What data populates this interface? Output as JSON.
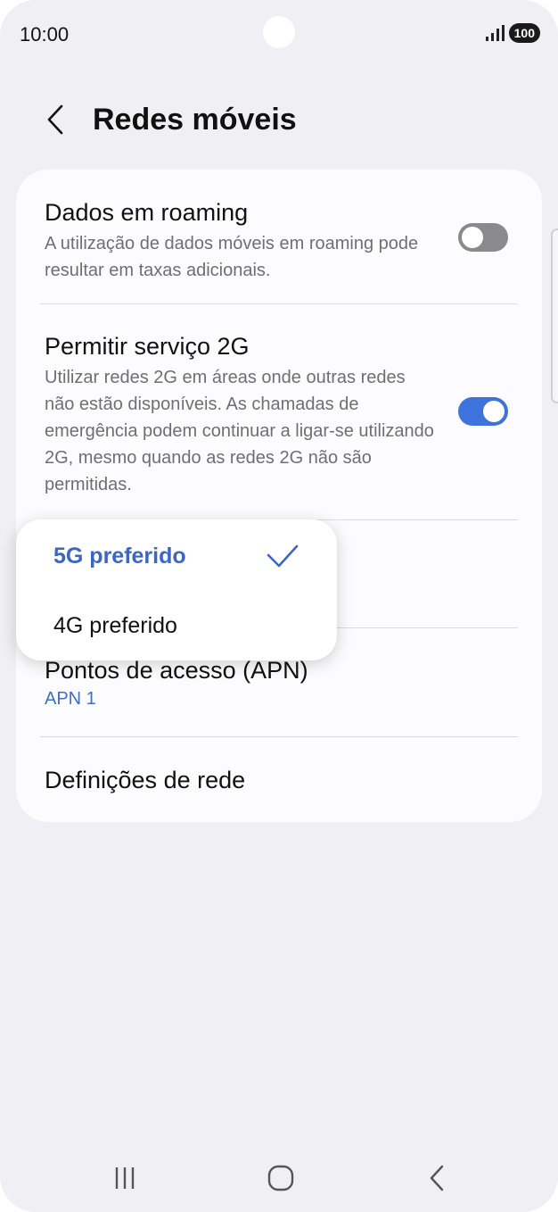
{
  "status_bar": {
    "time": "10:00",
    "battery": "100",
    "signal_icon": "signal-bars-icon"
  },
  "header": {
    "title": "Redes móveis",
    "back_icon": "chevron-left-icon"
  },
  "settings": {
    "roaming": {
      "title": "Dados em roaming",
      "description": "A utilização de dados móveis em roaming pode resultar em taxas adicionais.",
      "enabled": false
    },
    "service_2g": {
      "title": "Permitir serviço 2G",
      "description": "Utilizar redes 2G em áreas onde outras redes não estão disponíveis. As chamadas de emergência podem continuar a ligar-se utilizando 2G, mesmo quando as redes 2G não são permitidas.",
      "enabled": true
    },
    "apn": {
      "title": "Pontos de acesso (APN)",
      "value": "APN 1"
    },
    "network_settings": {
      "title": "Definições de rede"
    }
  },
  "network_mode_popup": {
    "options": [
      {
        "label": "5G preferido",
        "selected": true
      },
      {
        "label": "4G preferido",
        "selected": false
      }
    ]
  },
  "colors": {
    "accent": "#3e73dd",
    "selected_text": "#3b66c4",
    "background": "#f0f0f4",
    "card": "#fcfcfe"
  },
  "nav_bar": {
    "recents_icon": "recents-icon",
    "home_icon": "home-icon",
    "back_icon": "back-icon"
  }
}
